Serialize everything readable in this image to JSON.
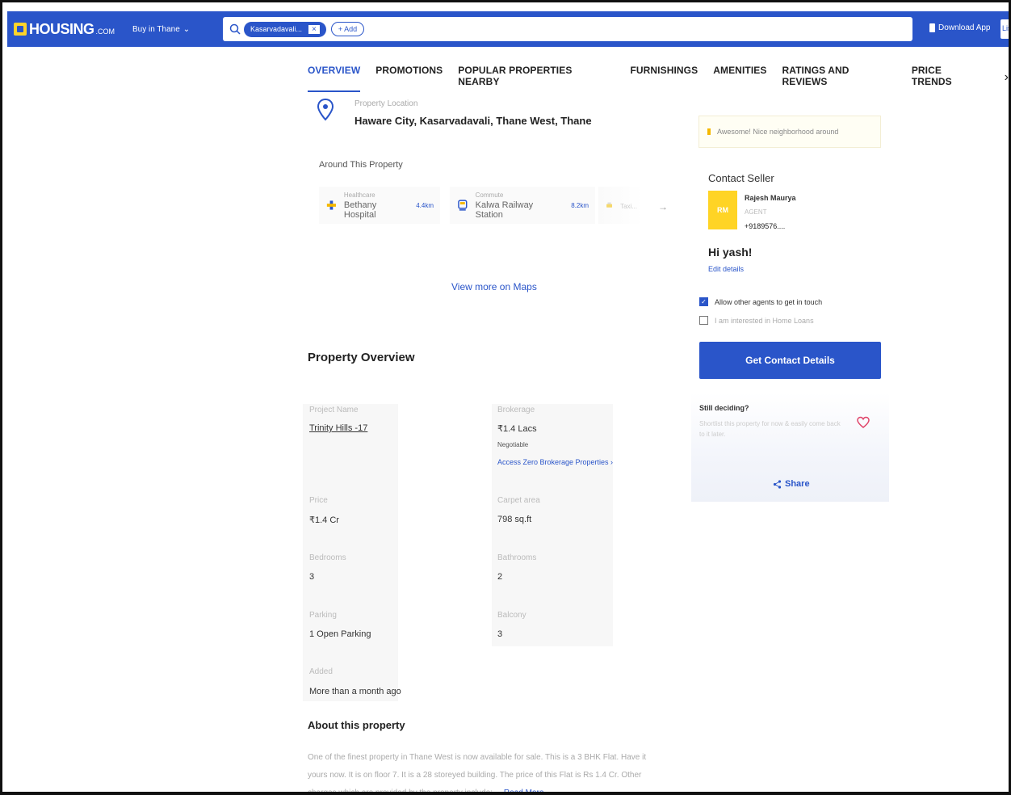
{
  "header": {
    "logo_text": "HOUSING",
    "logo_sub": ".COM",
    "city_label": "Buy in Thane",
    "search_chip": "Kasarvadavali...",
    "add_label": "+ Add",
    "download_app": "Download App",
    "list_label": "List"
  },
  "tabs": {
    "items": [
      "OVERVIEW",
      "PROMOTIONS",
      "POPULAR PROPERTIES NEARBY",
      "FURNISHINGS",
      "AMENITIES",
      "RATINGS AND REVIEWS",
      "PRICE TRENDS"
    ],
    "active": "OVERVIEW"
  },
  "location": {
    "label": "Property Location",
    "address": "Haware City, Kasarvadavali, Thane West, Thane"
  },
  "around": {
    "title": "Around This Property",
    "places": [
      {
        "category": "Healthcare",
        "name": "Bethany Hospital",
        "distance": "4.4km"
      },
      {
        "category": "Commute",
        "name": "Kalwa Railway Station",
        "distance": "8.2km"
      },
      {
        "category": "",
        "name": "Taxi...",
        "distance": ""
      }
    ],
    "view_more": "View more on Maps"
  },
  "overview": {
    "title": "Property Overview",
    "project_label": "Project Name",
    "project_value": "Trinity Hills -17",
    "brokerage_label": "Brokerage",
    "brokerage_value": "₹1.4 Lacs",
    "brokerage_note": "Negotiable",
    "brokerage_link": "Access Zero Brokerage Properties ›",
    "price_label": "Price",
    "price_value": "₹1.4 Cr",
    "carpet_label": "Carpet area",
    "carpet_value": "798 sq.ft",
    "bedrooms_label": "Bedrooms",
    "bedrooms_value": "3",
    "bathrooms_label": "Bathrooms",
    "bathrooms_value": "2",
    "parking_label": "Parking",
    "parking_value": "1 Open Parking",
    "balcony_label": "Balcony",
    "balcony_value": "3",
    "added_label": "Added",
    "added_value": "More than a month ago"
  },
  "about": {
    "title": "About this property",
    "text": "One of the finest property in Thane West is now available for sale. This is a 3 BHK Flat. Have it yours now. It is on floor 7. It is a 28 storeyed building. The price of this Flat is Rs 1.4 Cr. Other charges which are provided by the property include: ...",
    "read_more": "Read More"
  },
  "sidebar": {
    "banner": "Awesome! Nice neighborhood around",
    "contact_title": "Contact Seller",
    "avatar_initials": "RM",
    "seller_name": "Rajesh Maurya",
    "seller_role": "AGENT",
    "seller_phone": "+9189576....",
    "greeting": "Hi yash!",
    "edit_details": "Edit details",
    "cb_agents": "Allow other agents to get in touch",
    "cb_loans": "I am interested in Home Loans",
    "contact_button": "Get Contact Details",
    "still_title": "Still deciding?",
    "still_sub": "Shortlist this property for now & easily come back to it later.",
    "share": "Share"
  },
  "colors": {
    "brand_blue": "#2a55c9",
    "logo_yellow": "#ffd42a",
    "heart_pink": "#e0456a"
  }
}
